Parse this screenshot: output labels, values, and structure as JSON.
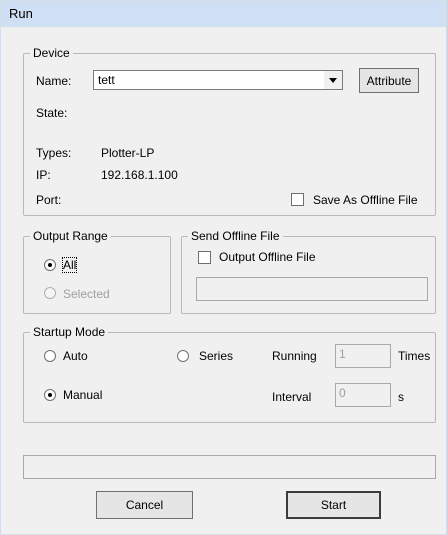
{
  "window": {
    "title": "Run"
  },
  "device": {
    "legend": "Device",
    "name_label": "Name:",
    "name_value": "tett",
    "attribute_button": "Attribute",
    "state_label": "State:",
    "types_label": "Types:",
    "types_value": "Plotter-LP",
    "ip_label": "IP:",
    "ip_value": "192.168.1.100",
    "port_label": "Port:",
    "save_offline_label": "Save As Offline File",
    "save_offline_checked": false
  },
  "output_range": {
    "legend": "Output Range",
    "all_label": "All",
    "selected_label": "Selected",
    "selected_option": "All"
  },
  "send_offline": {
    "legend": "Send Offline File",
    "output_offline_label": "Output Offline File",
    "output_offline_checked": false,
    "path_value": ""
  },
  "startup_mode": {
    "legend": "Startup Mode",
    "auto_label": "Auto",
    "series_label": "Series",
    "manual_label": "Manual",
    "selected_option": "Manual",
    "running_label": "Running",
    "running_value": "1",
    "times_label": "Times",
    "interval_label": "Interval",
    "interval_value": "0",
    "interval_unit": "s"
  },
  "status_bar": {
    "text": ""
  },
  "buttons": {
    "cancel": "Cancel",
    "start": "Start"
  }
}
